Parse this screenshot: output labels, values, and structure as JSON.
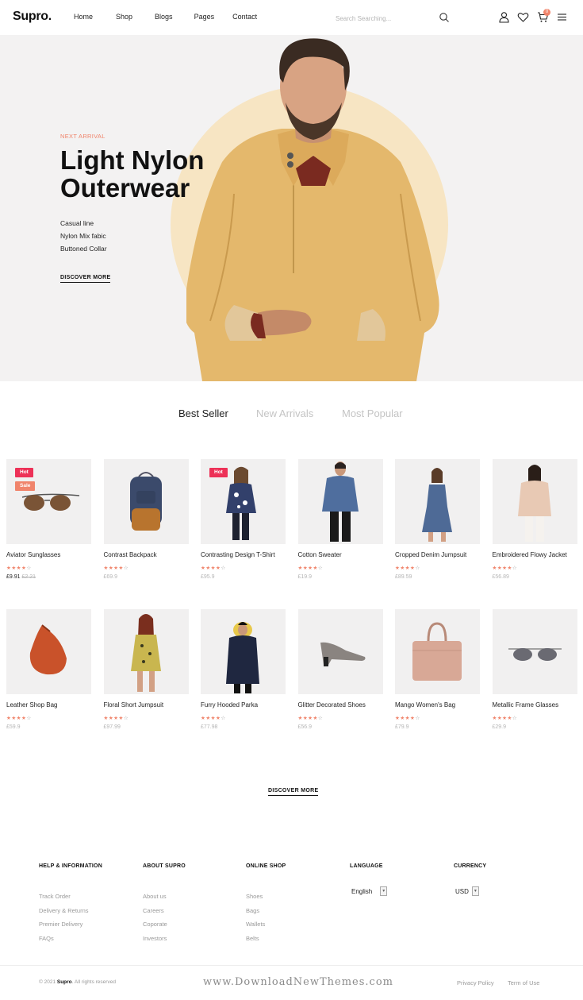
{
  "header": {
    "logo": "Supro.",
    "nav": [
      "Home",
      "Shop",
      "Blogs",
      "Pages",
      "Contact"
    ],
    "search_placeholder": "Search Searching...",
    "cart_count": "0",
    "icons": [
      "search-icon",
      "user-icon",
      "heart-icon",
      "cart-icon",
      "menu-icon"
    ]
  },
  "hero": {
    "kicker": "NEXT ARRIVAL",
    "title_line1": "Light Nylon",
    "title_line2": "Outerwear",
    "features": [
      "Casual line",
      "Nylon Mix fabic",
      "Buttoned Collar"
    ],
    "cta": "DISCOVER MORE",
    "circle_color": "#f7e5c3"
  },
  "tabs": [
    {
      "label": "Best Seller",
      "active": true
    },
    {
      "label": "New Arrivals",
      "active": false
    },
    {
      "label": "Most Popular",
      "active": false
    }
  ],
  "products": [
    {
      "name": "Aviator Sunglasses",
      "price": "£9.91",
      "old_price": "£2.21",
      "rating": 4,
      "badges": [
        "Hot",
        "Sale"
      ]
    },
    {
      "name": "Contrast Backpack",
      "price": "£69.9",
      "rating": 4,
      "badges": []
    },
    {
      "name": "Contrasting Design T-Shirt",
      "price": "£95.9",
      "rating": 4,
      "badges": [
        "Hot"
      ]
    },
    {
      "name": "Cotton Sweater",
      "price": "£19.9",
      "rating": 4,
      "badges": []
    },
    {
      "name": "Cropped Denim Jumpsuit",
      "price": "£89.59",
      "rating": 4,
      "badges": []
    },
    {
      "name": "Embroidered Flowy Jacket",
      "price": "£56.89",
      "rating": 4,
      "badges": []
    },
    {
      "name": "Leather Shop Bag",
      "price": "£59.9",
      "rating": 4,
      "badges": []
    },
    {
      "name": "Floral Short Jumpsuit",
      "price": "£97.99",
      "rating": 4,
      "badges": []
    },
    {
      "name": "Furry Hooded Parka",
      "price": "£77.98",
      "rating": 4,
      "badges": []
    },
    {
      "name": "Glitter Decorated Shoes",
      "price": "£56.9",
      "rating": 4,
      "badges": []
    },
    {
      "name": "Mango Women's Bag",
      "price": "£79.9",
      "rating": 4,
      "badges": []
    },
    {
      "name": "Metallic Frame Glasses",
      "price": "£29.9",
      "rating": 4,
      "badges": []
    }
  ],
  "discover_more": "DISCOVER MORE",
  "footer": {
    "help": {
      "heading": "HELP & INFORMATION",
      "links": [
        "Track Order",
        "Delivery & Returns",
        "Premier Delivery",
        "FAQs"
      ]
    },
    "about": {
      "heading": "ABOUT SUPRO",
      "links": [
        "About us",
        "Careers",
        "Coporate",
        "Investors"
      ]
    },
    "shop": {
      "heading": "ONLINE SHOP",
      "links": [
        "Shoes",
        "Bags",
        "Wallets",
        "Belts"
      ]
    },
    "language": {
      "heading": "LANGUAGE",
      "value": "English"
    },
    "currency": {
      "heading": "CURRENCY",
      "value": "USD"
    },
    "copyright_year": "© 2021",
    "copyright_brand": "Supro",
    "copyright_rest": ". All rights reserved",
    "privacy": "Privacy Policy",
    "terms": "Term of Use",
    "watermark": "www.DownloadNewThemes.com"
  },
  "colors": {
    "accent": "#f0846b",
    "hot": "#ed3157",
    "hero_bg": "#f3f2f2"
  }
}
